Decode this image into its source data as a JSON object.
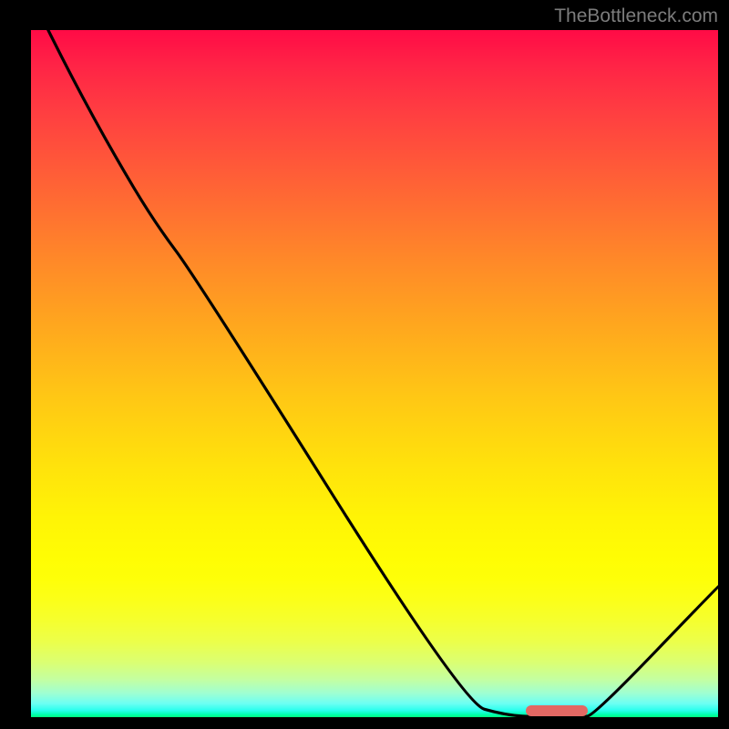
{
  "watermark": "TheBottleneck.com",
  "colors": {
    "gradient_top": "#ff0b46",
    "gradient_bottom": "#01ff7f",
    "curve_stroke": "#000000",
    "marker": "#e36864",
    "watermark_text": "#7c7c7c",
    "background": "#000000"
  },
  "chart_data": {
    "type": "line",
    "title": "",
    "xlabel": "",
    "ylabel": "",
    "x": [
      0.0,
      0.06,
      0.12,
      0.18,
      0.24,
      0.63,
      0.69,
      0.74,
      0.8,
      0.82,
      1.0
    ],
    "values": [
      1.05,
      0.93,
      0.82,
      0.72,
      0.64,
      0.02,
      0.003,
      0.0,
      0.0,
      0.003,
      0.19
    ],
    "xlim": [
      0,
      1
    ],
    "ylim": [
      0,
      1
    ],
    "marker": {
      "x_start": 0.72,
      "x_end": 0.81,
      "y": 0.0
    },
    "grid": false,
    "legend": false
  }
}
